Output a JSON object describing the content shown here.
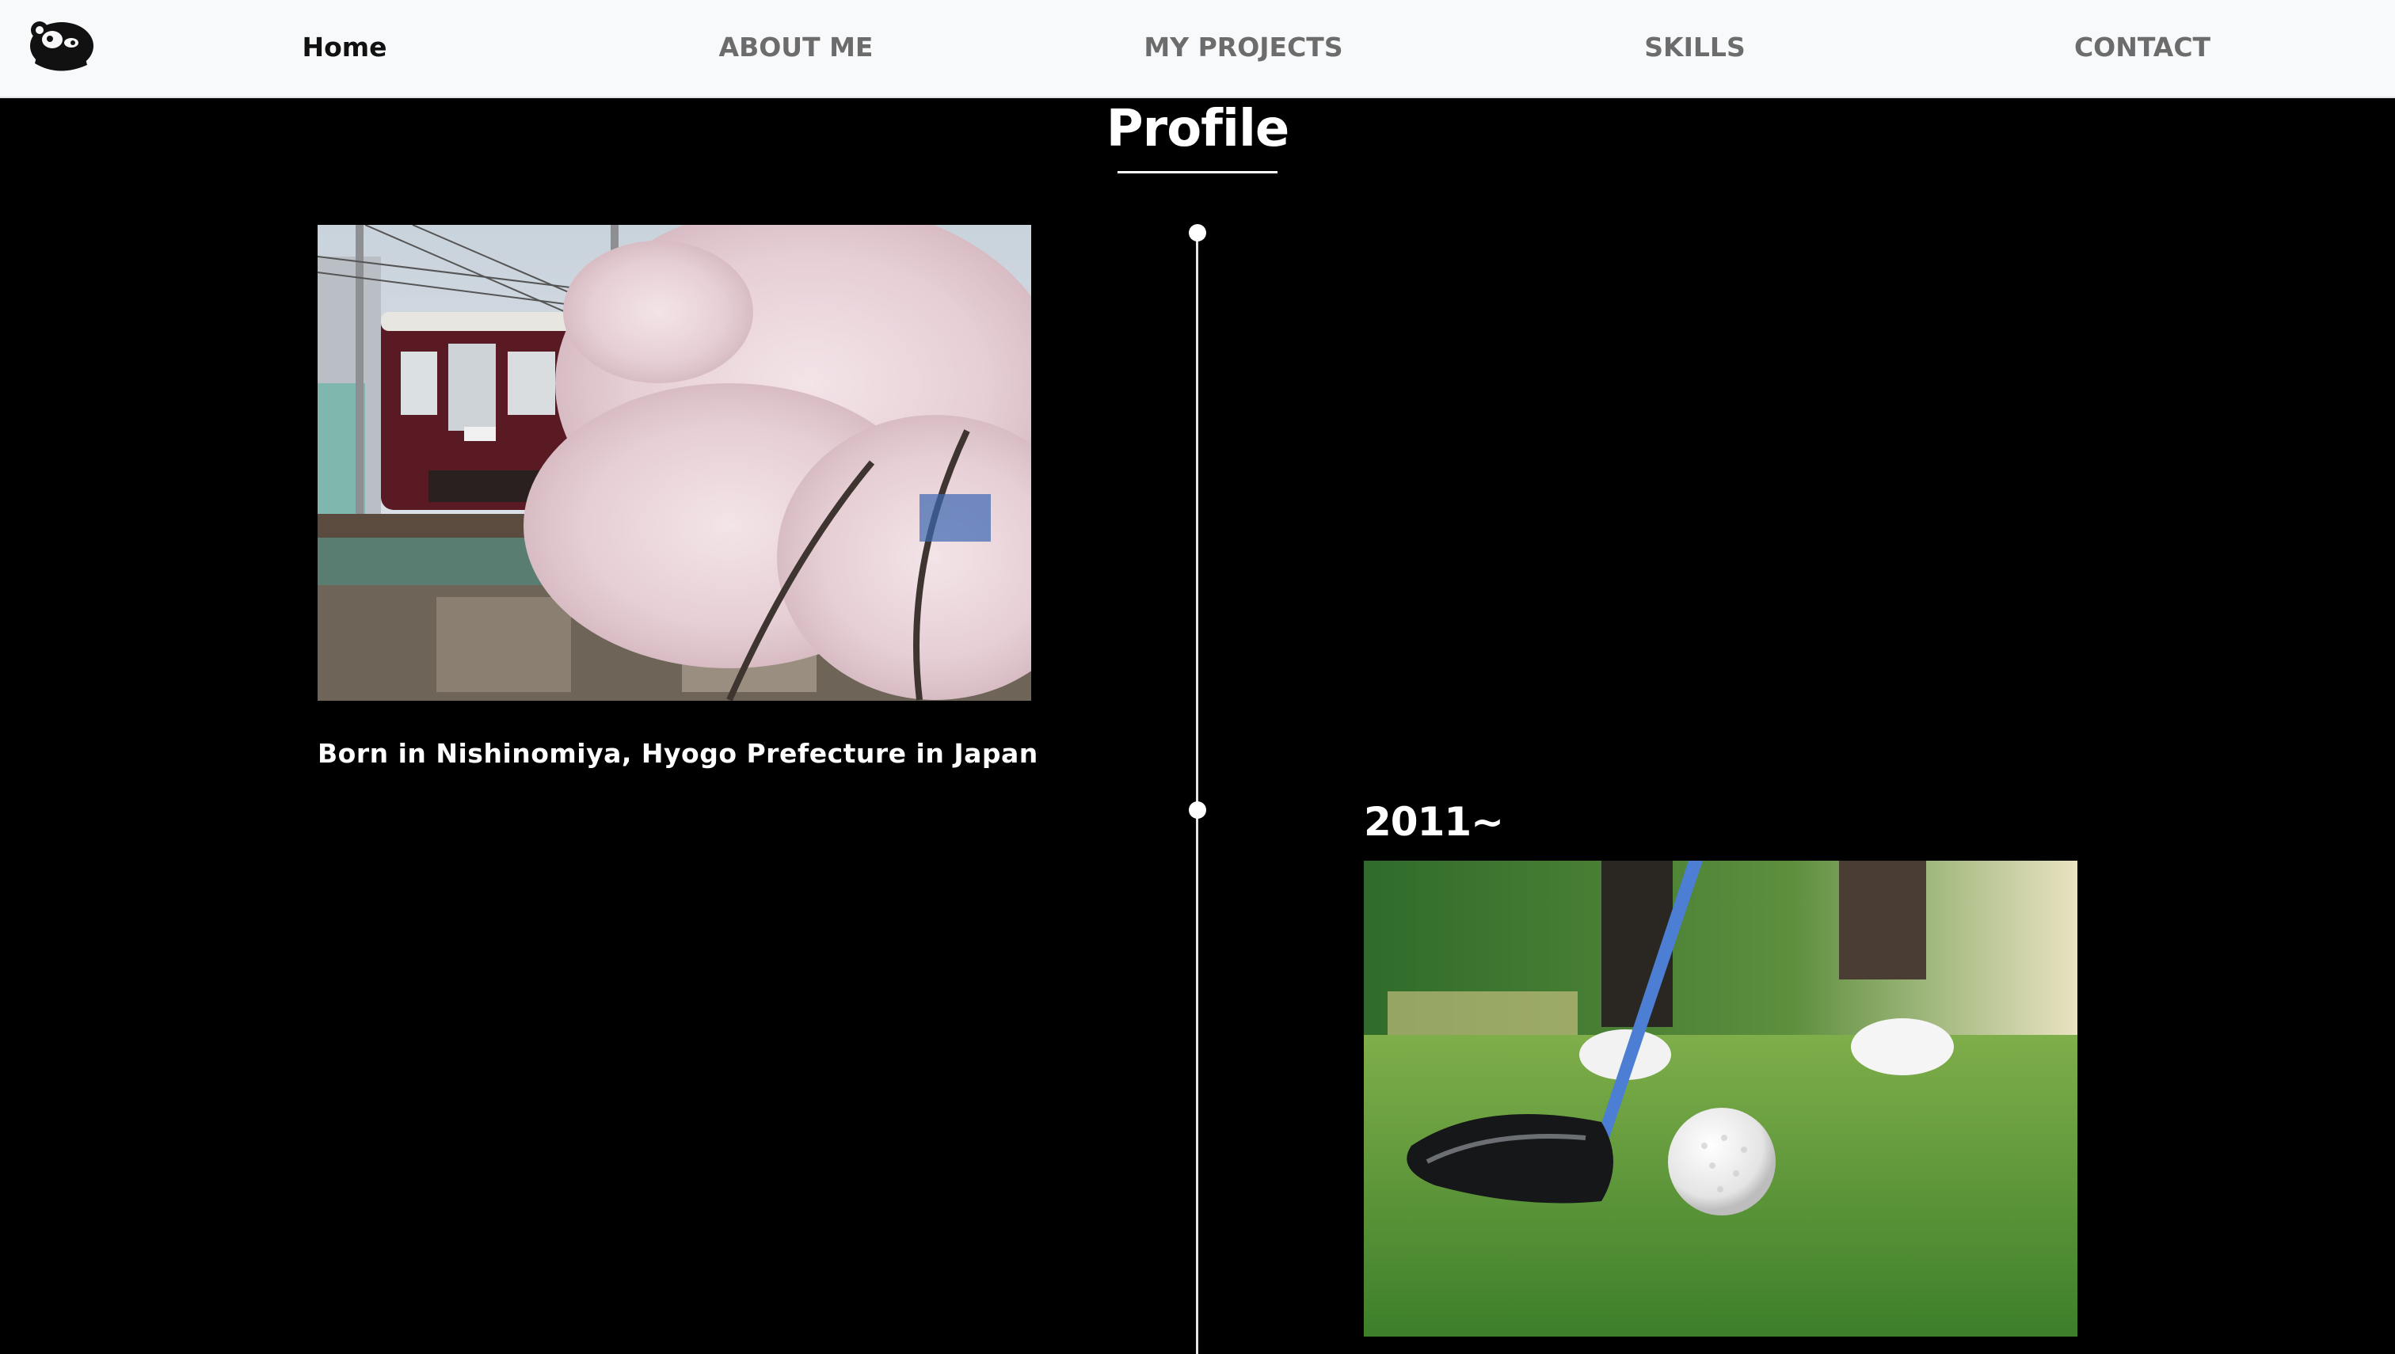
{
  "nav": {
    "logo_icon": "otter-logo-icon",
    "items": [
      {
        "label": "Home",
        "active": true
      },
      {
        "label": "ABOUT ME",
        "active": false
      },
      {
        "label": "MY PROJECTS",
        "active": false
      },
      {
        "label": "SKILLS",
        "active": false
      },
      {
        "label": "CONTACT",
        "active": false
      }
    ]
  },
  "profile": {
    "title": "Profile",
    "timeline": [
      {
        "image": "cherry-blossom-train-photo",
        "caption": "Born in Nishinomiya, Hyogo Prefecture in Japan"
      },
      {
        "year": "2011~",
        "image": "golf-ball-driver-photo"
      }
    ]
  },
  "colors": {
    "nav_bg": "#f8f9fa",
    "nav_text": "#6c6c6c",
    "nav_active": "#111111",
    "page_bg": "#000000",
    "text": "#ffffff"
  }
}
